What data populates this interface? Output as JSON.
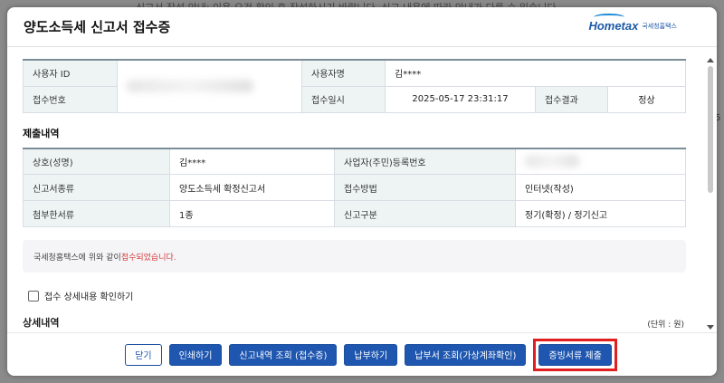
{
  "background": {
    "top_text": "신고서 작성 안내: 이용 요건 확인 후 작성하시기 바랍니다. 신고 내용에 따라 안내가 다를 수 있습니다.",
    "side_mark": "5"
  },
  "modal": {
    "title": "양도소득세 신고서 접수증",
    "logo": {
      "word": "Hometax",
      "sub": "국세청홈택스"
    }
  },
  "info_table": {
    "user_id_label": "사용자 ID",
    "user_id_value": "",
    "user_name_label": "사용자명",
    "user_name_value": "김****",
    "receipt_no_label": "접수번호",
    "receipt_no_value": "",
    "receipt_time_label": "접수일시",
    "receipt_time_value": "2025-05-17 23:31:17",
    "receipt_result_label": "접수결과",
    "receipt_result_value": "정상"
  },
  "submission": {
    "title": "제출내역",
    "name_label": "상호(성명)",
    "name_value": "김****",
    "reg_no_label": "사업자(주민)등록번호",
    "reg_no_value": "",
    "form_type_label": "신고서종류",
    "form_type_value": "양도소득세 확정신고서",
    "method_label": "접수방법",
    "method_value": "인터넷(작성)",
    "attach_label": "첨부한서류",
    "attach_value": "1종",
    "category_label": "신고구분",
    "category_value": "정기(확정) / 정기신고"
  },
  "notice": {
    "prefix": "국세청홈택스에 위와 같이 ",
    "highlight": "접수되었습니다."
  },
  "checkbox": {
    "label": "접수 상세내용 확인하기",
    "checked": false
  },
  "detail": {
    "title": "상세내역",
    "unit": "(단위 : 원)"
  },
  "buttons": {
    "close": "닫기",
    "print": "인쇄하기",
    "history": "신고내역 조회 (접수증)",
    "pay": "납부하기",
    "pay_slip": "납부서 조회(가상계좌확인)",
    "evidence": "증빙서류 제출"
  },
  "colors": {
    "primary": "#1e56b0",
    "highlight_border": "#e02020",
    "header_cell": "#eef4f4"
  }
}
